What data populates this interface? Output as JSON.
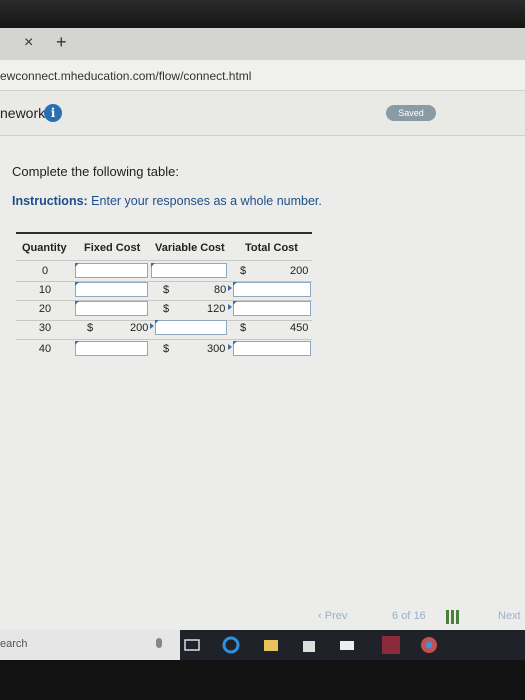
{
  "browser": {
    "tab_close": "×",
    "tab_new": "+",
    "url": "ewconnect.mheducation.com/flow/connect.html"
  },
  "app": {
    "title": "nework",
    "info_icon": "i",
    "saved_label": "Saved"
  },
  "instructions": {
    "title": "Complete the following table:",
    "label": "Instructions:",
    "text": " Enter your responses as a whole number."
  },
  "table": {
    "headers": [
      "Quantity",
      "Fixed Cost",
      "Variable Cost",
      "Total Cost"
    ],
    "rows": [
      {
        "quantity": "0",
        "fixed": "",
        "variable": "",
        "total": "200"
      },
      {
        "quantity": "10",
        "fixed": "",
        "variable": "80",
        "total": ""
      },
      {
        "quantity": "20",
        "fixed": "",
        "variable": "120",
        "total": ""
      },
      {
        "quantity": "30",
        "fixed": "200",
        "variable": "",
        "total": "450"
      },
      {
        "quantity": "40",
        "fixed": "",
        "variable": "300",
        "total": ""
      }
    ],
    "currency": "$"
  },
  "footer": {
    "prev": "Prev",
    "page_current": "6",
    "page_of": "of",
    "page_total": "16",
    "next": "Next"
  },
  "taskbar": {
    "search": "earch"
  },
  "colors": {
    "link_blue": "#1d4f8a",
    "accent": "#2a6fb3",
    "saved_badge": "#8b9ba6"
  }
}
